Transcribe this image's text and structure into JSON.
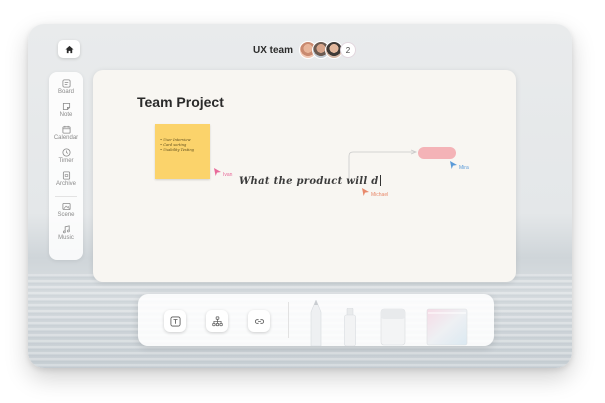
{
  "header": {
    "team_name": "UX team",
    "member_count": "2",
    "avatars": [
      "user-avatar",
      "user-avatar",
      "user-avatar"
    ]
  },
  "sidebar": {
    "items": [
      {
        "label": "Board",
        "icon": "board-icon"
      },
      {
        "label": "Note",
        "icon": "note-icon"
      },
      {
        "label": "Calendar",
        "icon": "calendar-icon"
      },
      {
        "label": "Timer",
        "icon": "clock-icon"
      },
      {
        "label": "Archive",
        "icon": "archive-icon"
      },
      {
        "label": "Scene",
        "icon": "scene-icon"
      },
      {
        "label": "Music",
        "icon": "music-icon"
      }
    ]
  },
  "canvas": {
    "title": "Team Project",
    "sticky_note": {
      "items": [
        "• User Interview",
        "• Card sorting",
        "• Usability Testing"
      ]
    },
    "handwriting": "What the product will d",
    "cursors": [
      {
        "name": "Ivan",
        "color": "#e86a9a"
      },
      {
        "name": "Michael",
        "color": "#e8886a"
      },
      {
        "name": "Mira",
        "color": "#5a9ad8"
      }
    ],
    "pill_color": "#f4b3b7"
  },
  "toolbar": {
    "tools": [
      {
        "icon": "text-icon"
      },
      {
        "icon": "hierarchy-icon"
      },
      {
        "icon": "link-icon"
      }
    ],
    "objects": [
      "pen-tool",
      "marker-tool",
      "eraser-tool",
      "sticky-pad-tool"
    ]
  },
  "colors": {
    "accent_pink": "#f4b3b7",
    "sticky_yellow": "#fbd36b"
  }
}
